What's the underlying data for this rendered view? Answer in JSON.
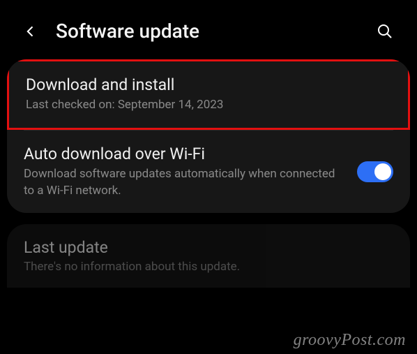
{
  "header": {
    "title": "Software update"
  },
  "card1": {
    "download": {
      "title": "Download and install",
      "subtitle": "Last checked on: September 14, 2023"
    },
    "auto": {
      "title": "Auto download over Wi-Fi",
      "subtitle": "Download software updates automatically when connected to a Wi-Fi network.",
      "toggle_on": true
    }
  },
  "card2": {
    "last_update": {
      "title": "Last update",
      "subtitle": "There's no information about this update."
    }
  },
  "watermark": "groovyPost.com",
  "highlight_color": "#e31010",
  "toggle_color": "#2d6ff5"
}
